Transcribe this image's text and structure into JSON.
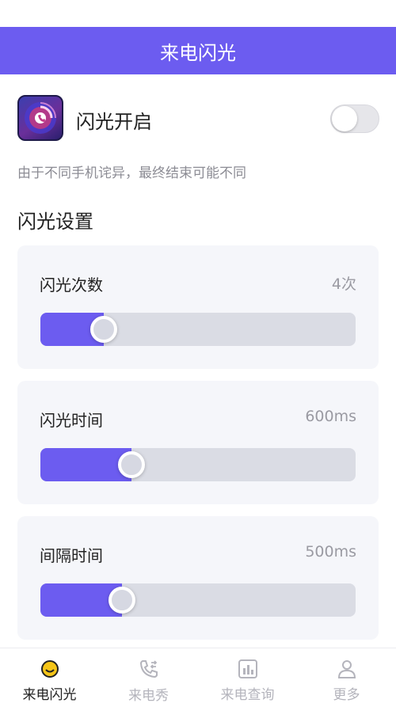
{
  "header": {
    "title": "来电闪光"
  },
  "toggle": {
    "label": "闪光开启",
    "enabled": false
  },
  "note": "由于不同手机诧异，最终结束可能不同",
  "section_title": "闪光设置",
  "settings": [
    {
      "label": "闪光次数",
      "value": "4次",
      "level": 0.2
    },
    {
      "label": "闪光时间",
      "value": "600ms",
      "level": 0.29
    },
    {
      "label": "间隔时间",
      "value": "500ms",
      "level": 0.26
    }
  ],
  "nav": [
    {
      "label": "来电闪光",
      "icon": "smile-face-icon",
      "active": true
    },
    {
      "label": "来电秀",
      "icon": "phone-transfer-icon",
      "active": false
    },
    {
      "label": "来电查询",
      "icon": "bar-chart-icon",
      "active": false
    },
    {
      "label": "更多",
      "icon": "person-icon",
      "active": false
    }
  ],
  "colors": {
    "accent": "#6c5cf0",
    "active_nav_icon": "#f5c518"
  }
}
